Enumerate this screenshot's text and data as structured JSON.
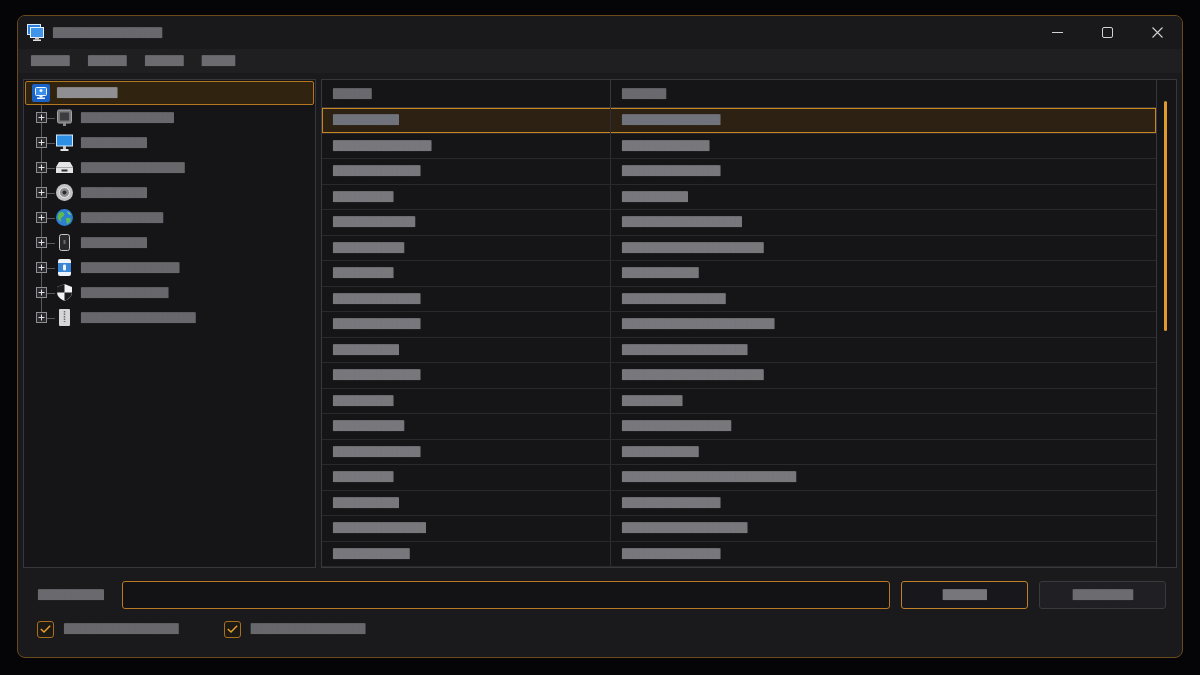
{
  "window": {
    "title": "████████████████████"
  },
  "menu": [
    "███████",
    "███████",
    "███████",
    "██████"
  ],
  "tree": {
    "label": "███████████",
    "selected": true,
    "children": [
      {
        "label": "█████████████████",
        "expanded": false,
        "selected": false
      },
      {
        "label": "████████████",
        "expanded": false,
        "selected": false
      },
      {
        "label": "███████████████████",
        "expanded": false,
        "selected": false
      },
      {
        "label": "████████████",
        "expanded": false,
        "selected": false
      },
      {
        "label": "███████████████",
        "expanded": false,
        "selected": false
      },
      {
        "label": "████████████",
        "expanded": false,
        "selected": false
      },
      {
        "label": "██████████████████",
        "expanded": false,
        "selected": false
      },
      {
        "label": "████████████████",
        "expanded": false,
        "selected": false
      },
      {
        "label": "█████████████████████",
        "expanded": false,
        "selected": false
      }
    ]
  },
  "table": {
    "columns": [
      "███████",
      "████████"
    ],
    "rows": [
      {
        "cells": [
          "████████████",
          "██████████████████"
        ],
        "selected": true
      },
      {
        "cells": [
          "██████████████████",
          "████████████████"
        ],
        "selected": false
      },
      {
        "cells": [
          "████████████████",
          "██████████████████"
        ],
        "selected": false
      },
      {
        "cells": [
          "███████████",
          "████████████"
        ],
        "selected": false
      },
      {
        "cells": [
          "███████████████",
          "██████████████████████"
        ],
        "selected": false
      },
      {
        "cells": [
          "█████████████",
          "██████████████████████████"
        ],
        "selected": false
      },
      {
        "cells": [
          "███████████",
          "██████████████"
        ],
        "selected": false
      },
      {
        "cells": [
          "████████████████",
          "███████████████████"
        ],
        "selected": false
      },
      {
        "cells": [
          "████████████████",
          "████████████████████████████"
        ],
        "selected": false
      },
      {
        "cells": [
          "████████████",
          "███████████████████████"
        ],
        "selected": false
      },
      {
        "cells": [
          "████████████████",
          "██████████████████████████"
        ],
        "selected": false
      },
      {
        "cells": [
          "███████████",
          "███████████"
        ],
        "selected": false
      },
      {
        "cells": [
          "█████████████",
          "████████████████████"
        ],
        "selected": false
      },
      {
        "cells": [
          "████████████████",
          "██████████████"
        ],
        "selected": false
      },
      {
        "cells": [
          "███████████",
          "████████████████████████████████"
        ],
        "selected": false
      },
      {
        "cells": [
          "████████████",
          "██████████████████"
        ],
        "selected": false
      },
      {
        "cells": [
          "█████████████████",
          "███████████████████████"
        ],
        "selected": false
      },
      {
        "cells": [
          "██████████████",
          "██████████████████"
        ],
        "selected": false
      }
    ]
  },
  "search": {
    "label": "████████████"
  },
  "buttons": [
    {
      "label": "████████",
      "default": true,
      "disabled": false
    },
    {
      "label": "███████████",
      "default": false,
      "disabled": true
    }
  ],
  "checkboxes": [
    {
      "label": "█████████████████████",
      "checked": true
    },
    {
      "label": "█████████████████████",
      "checked": true
    }
  ]
}
